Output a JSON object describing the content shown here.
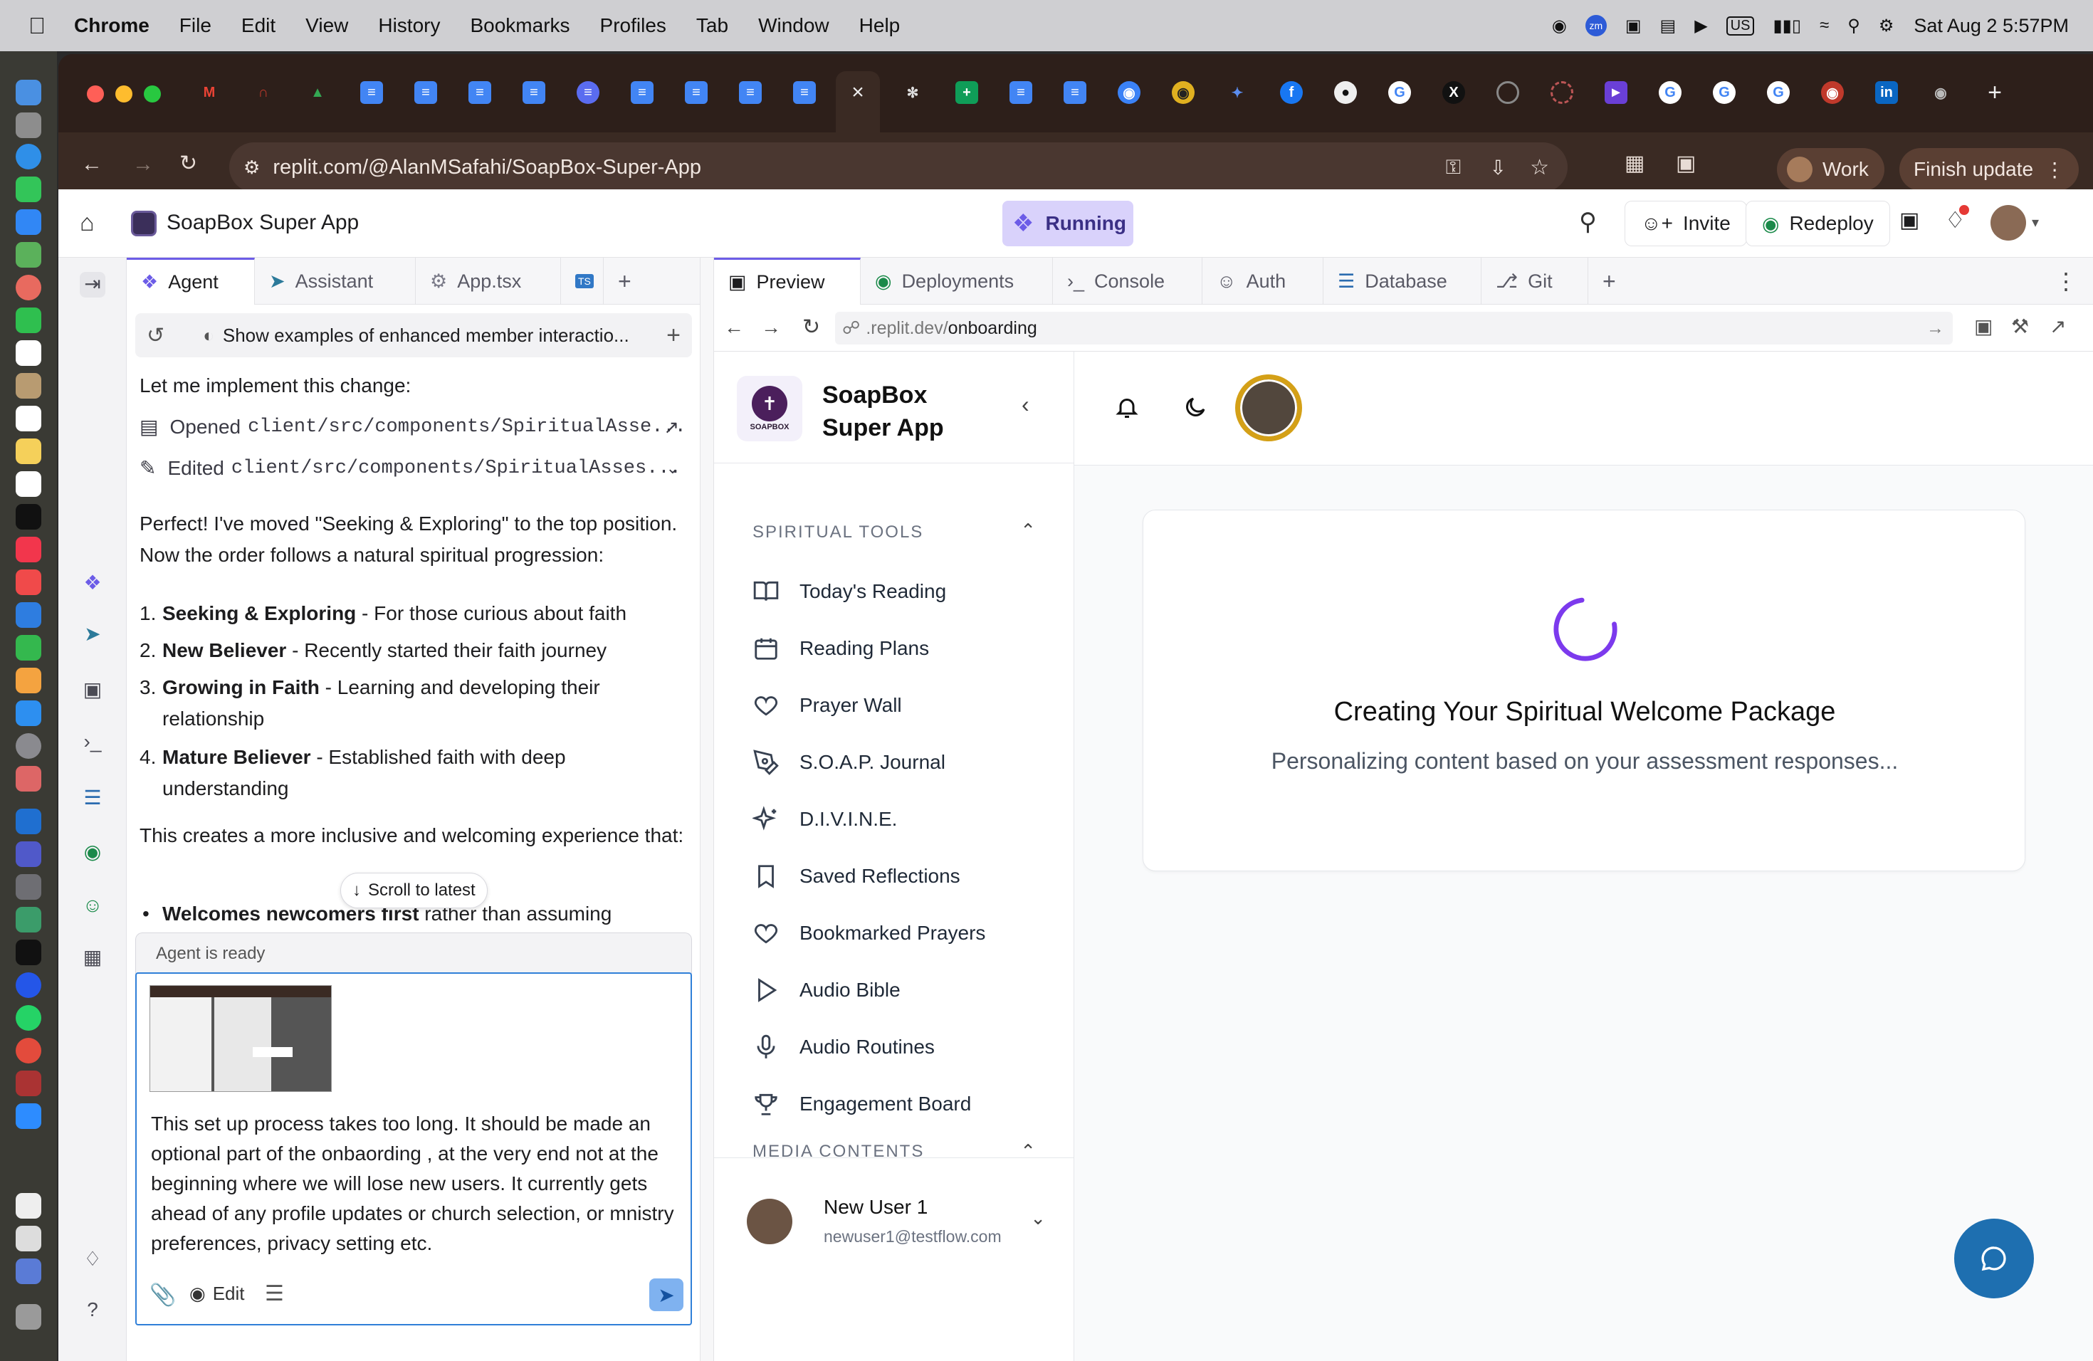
{
  "menubar": {
    "app": "Chrome",
    "items": [
      "File",
      "Edit",
      "View",
      "History",
      "Bookmarks",
      "Profiles",
      "Tab",
      "Window",
      "Help"
    ],
    "input_source": "US",
    "datetime": "Sat Aug 2  5:57PM"
  },
  "browser": {
    "url": "replit.com/@AlanMSafahi/SoapBox-Super-App",
    "profile": "Work",
    "finish_update": "Finish update"
  },
  "replit": {
    "project_title": "SoapBox Super App",
    "status": "Running",
    "invite": "Invite",
    "redeploy": "Redeploy",
    "left_tabs": [
      "Agent",
      "Assistant",
      "App.tsx"
    ],
    "chat_header": "Show examples of enhanced member interactio...",
    "chat": {
      "intro": "Let me implement this change:",
      "opened_label": "Opened",
      "opened_path": "client/src/components/SpiritualAsse...",
      "edited_label": "Edited",
      "edited_path": "client/src/components/SpiritualAsses...",
      "para1": "Perfect! I've moved \"Seeking & Exploring\" to the top position. Now the order follows a natural spiritual progression:",
      "list": [
        {
          "bold": "Seeking & Exploring",
          "rest": " - For those curious about faith"
        },
        {
          "bold": "New Believer",
          "rest": " - Recently started their faith journey"
        },
        {
          "bold": "Growing in Faith",
          "rest": " - Learning and developing their relationship"
        },
        {
          "bold": "Mature Believer",
          "rest": " - Established faith with deep understanding"
        }
      ],
      "para2": "This creates a more inclusive and welcoming experience that:",
      "bullet_bold": "Welcomes newcomers first",
      "bullet_rest": " rather than assuming",
      "scroll_latest": "Scroll to latest",
      "agent_status": "Agent is ready",
      "input_text": "This set up process takes too long. It should be made an optional part of the onbaording ,  at the very end not at the beginning where we will lose new users. It currently gets ahead of any profile updates  or church selection, or mnistry preferences,  privacy setting etc.",
      "edit_label": "Edit"
    },
    "preview_tabs": [
      "Preview",
      "Deployments",
      "Console",
      "Auth",
      "Database",
      "Git"
    ],
    "preview_url_prefix": ".replit.dev/",
    "preview_url_path": "onboarding"
  },
  "site": {
    "brand_line1": "SoapBox",
    "brand_line2": "Super App",
    "logo_text": "SOAPBOX",
    "section1": "SPIRITUAL TOOLS",
    "nav": [
      "Today's Reading",
      "Reading Plans",
      "Prayer Wall",
      "S.O.A.P. Journal",
      "D.I.V.I.N.E.",
      "Saved Reflections",
      "Bookmarked Prayers",
      "Audio Bible",
      "Audio Routines",
      "Engagement Board"
    ],
    "section2": "MEDIA CONTENTS",
    "user_name": "New User 1",
    "user_email": "newuser1@testflow.com",
    "loading_title": "Creating Your Spiritual Welcome Package",
    "loading_sub": "Personalizing content based on your assessment responses..."
  },
  "colors": {
    "accent": "#6c5ce7",
    "spinner": "#7c3aed",
    "running_bg": "#d9d2fb",
    "avatar_ring": "#d4a017",
    "fab": "#1e6fb0"
  }
}
